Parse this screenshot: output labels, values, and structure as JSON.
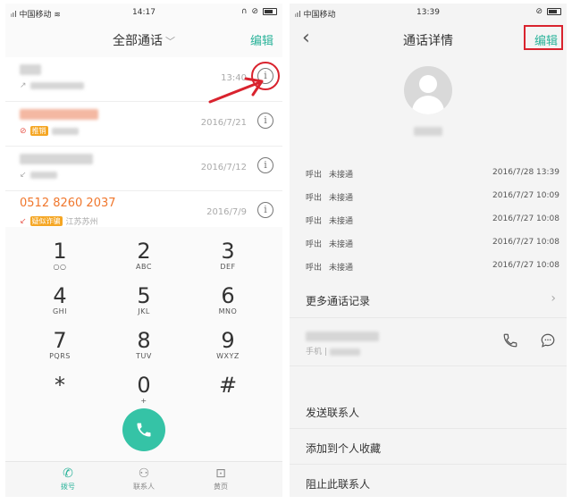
{
  "left": {
    "status": {
      "carrier": "中国移动",
      "time": "14:17"
    },
    "header": {
      "title": "全部通话",
      "edit_label": "编辑"
    },
    "calls": [
      {
        "date": "13:40"
      },
      {
        "tag": "推销",
        "date": "2016/7/21"
      },
      {
        "date": "2016/7/12"
      },
      {
        "name": "0512 8260 2037",
        "tag": "疑似诈骗",
        "location": "江苏苏州",
        "date": "2016/7/9"
      }
    ],
    "keypad": [
      {
        "digit": "1",
        "letters": ""
      },
      {
        "digit": "2",
        "letters": "ABC"
      },
      {
        "digit": "3",
        "letters": "DEF"
      },
      {
        "digit": "4",
        "letters": "GHI"
      },
      {
        "digit": "5",
        "letters": "JKL"
      },
      {
        "digit": "6",
        "letters": "MNO"
      },
      {
        "digit": "7",
        "letters": "PQRS"
      },
      {
        "digit": "8",
        "letters": "TUV"
      },
      {
        "digit": "9",
        "letters": "WXYZ"
      },
      {
        "digit": "*",
        "letters": ""
      },
      {
        "digit": "0",
        "letters": "+"
      },
      {
        "digit": "#",
        "letters": ""
      }
    ],
    "nav": {
      "dial": "拨号",
      "contacts": "联系人",
      "yellow_pages": "黄页"
    }
  },
  "right": {
    "status": {
      "carrier": "中国移动",
      "time": "13:39"
    },
    "header": {
      "title": "通话详情",
      "edit_label": "编辑"
    },
    "records": [
      {
        "direction": "呼出",
        "status": "未接通",
        "time": "2016/7/28 13:39"
      },
      {
        "direction": "呼出",
        "status": "未接通",
        "time": "2016/7/27 10:09"
      },
      {
        "direction": "呼出",
        "status": "未接通",
        "time": "2016/7/27 10:08"
      },
      {
        "direction": "呼出",
        "status": "未接通",
        "time": "2016/7/27 10:08"
      },
      {
        "direction": "呼出",
        "status": "未接通",
        "time": "2016/7/27 10:08"
      }
    ],
    "more_records": "更多通话记录",
    "number_type": "手机",
    "actions": [
      "发送联系人",
      "添加到个人收藏",
      "阻止此联系人"
    ]
  },
  "colors": {
    "accent": "#2bb39a",
    "call_button": "#35c3a6",
    "highlight": "#d9232e",
    "spam": "#f0772d"
  }
}
